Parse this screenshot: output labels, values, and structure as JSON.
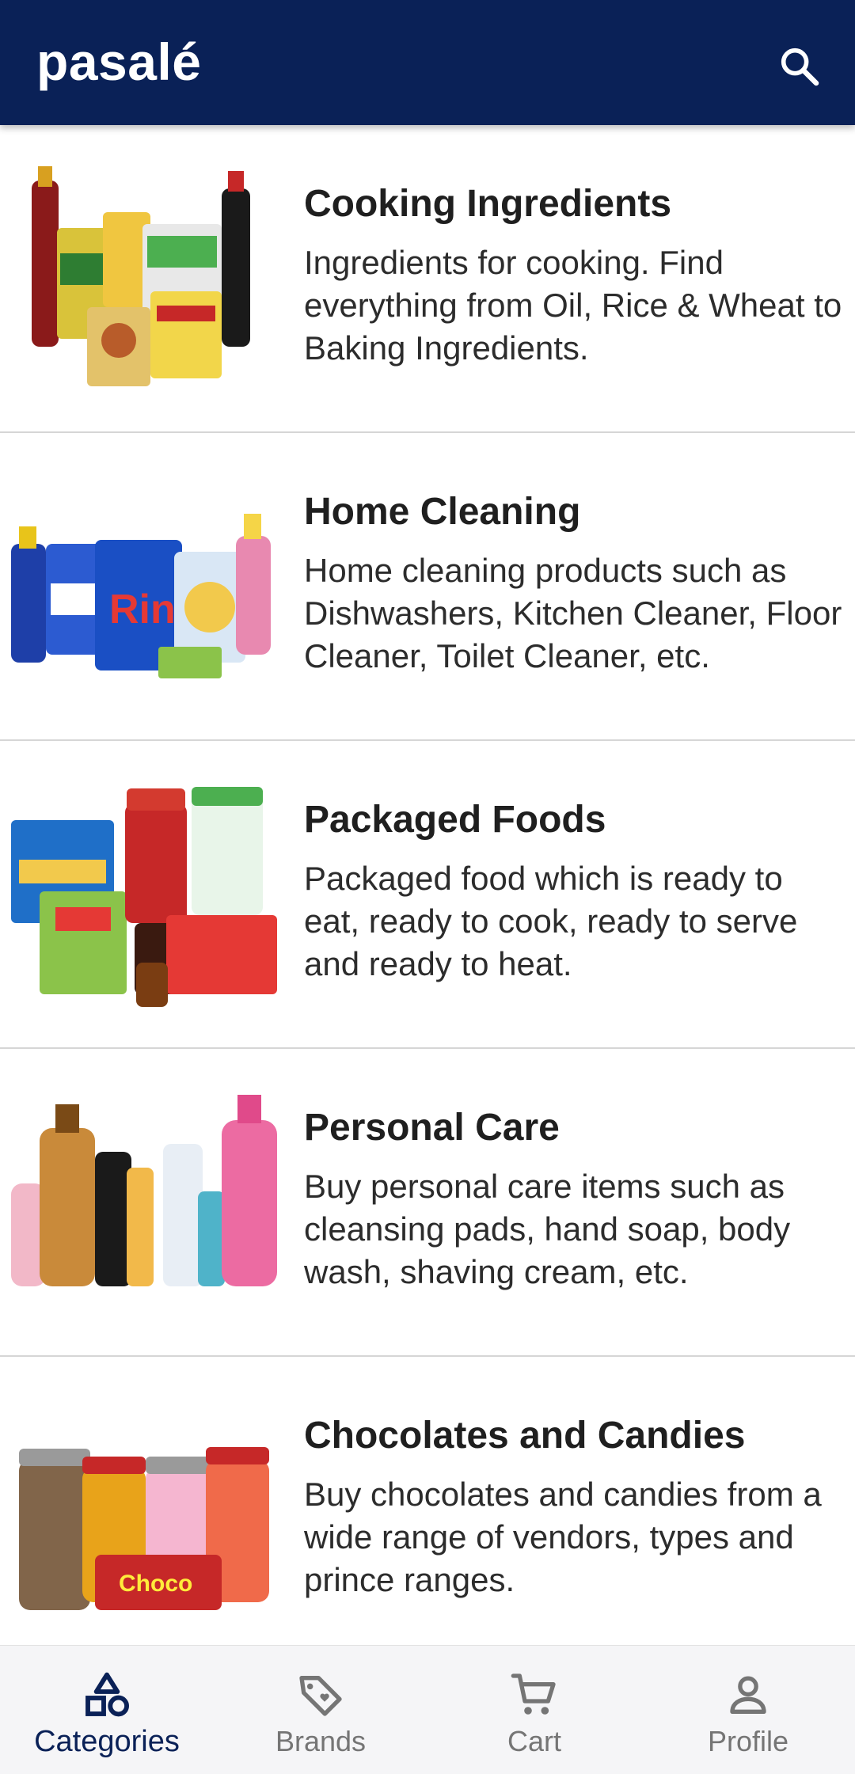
{
  "app": {
    "title": "pasalé"
  },
  "header": {
    "search_icon": "search-icon"
  },
  "categories": [
    {
      "title": "Cooking Ingredients",
      "description": "Ingredients for cooking. Find everything from Oil, Rice & Wheat to Baking Ingredients.",
      "image": "cooking-ingredients-products"
    },
    {
      "title": "Home Cleaning",
      "description": "Home cleaning products such as Dishwashers, Kitchen Cleaner, Floor Cleaner, Toilet Cleaner, etc.",
      "image": "home-cleaning-products"
    },
    {
      "title": "Packaged Foods",
      "description": "Packaged food which is ready to eat, ready to cook, ready to serve and ready to heat.",
      "image": "packaged-foods-products"
    },
    {
      "title": "Personal Care",
      "description": "Buy personal care items such as cleansing pads, hand soap, body wash, shaving cream, etc.",
      "image": "personal-care-products"
    },
    {
      "title": "Chocolates and Candies",
      "description": "Buy chocolates and candies from a wide range of vendors, types and prince ranges.",
      "image": "chocolates-candies-products"
    }
  ],
  "bottom_nav": [
    {
      "label": "Categories",
      "icon": "shapes-icon",
      "active": true
    },
    {
      "label": "Brands",
      "icon": "tag-heart-icon",
      "active": false
    },
    {
      "label": "Cart",
      "icon": "cart-icon",
      "active": false
    },
    {
      "label": "Profile",
      "icon": "person-icon",
      "active": false
    }
  ],
  "colors": {
    "appbar": "#0a2157",
    "active_nav": "#0a2157",
    "inactive_nav": "#757575"
  }
}
